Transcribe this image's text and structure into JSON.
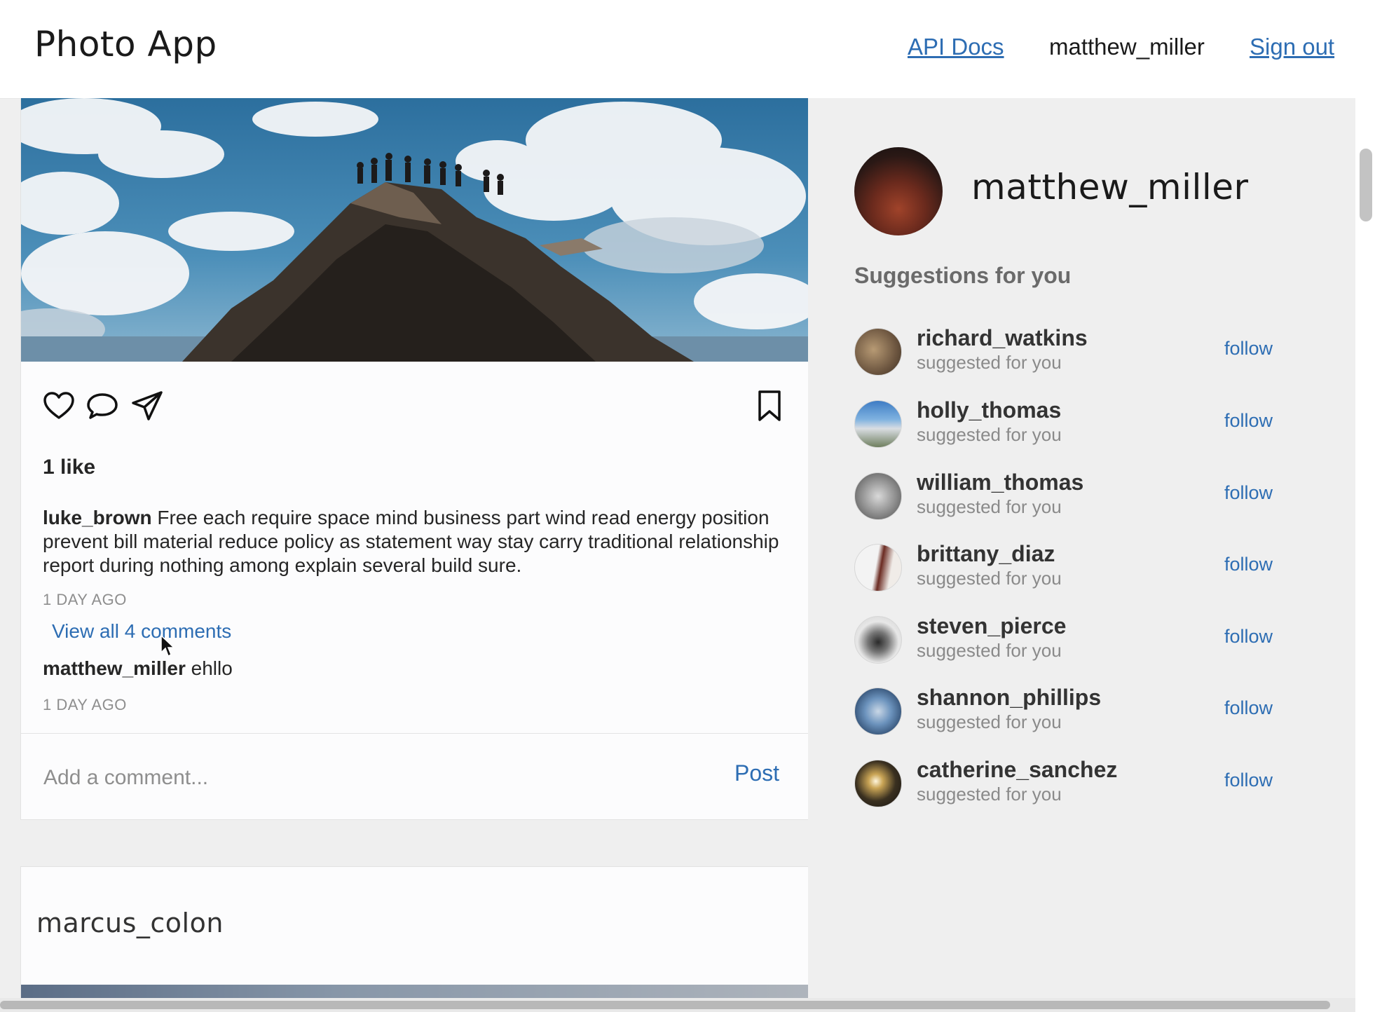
{
  "header": {
    "logo": "Photo App",
    "api_docs": "API Docs",
    "username": "matthew_miller",
    "sign_out": "Sign out"
  },
  "post": {
    "likes": "1 like",
    "author": "luke_brown",
    "caption": " Free each require space mind business part wind read energy position prevent bill material reduce policy as statement way stay carry traditional relationship report during nothing among explain several build sure.",
    "timestamp": "1 DAY AGO",
    "view_all_comments": "View all 4 comments",
    "comment_author": "matthew_miller",
    "comment_text": " ehllo",
    "comment_timestamp": "1 DAY AGO",
    "add_comment_placeholder": "Add a comment...",
    "post_button": "Post",
    "icons": [
      "heart-icon",
      "comment-icon",
      "share-icon",
      "bookmark-icon"
    ]
  },
  "next_post": {
    "author": "marcus_colon"
  },
  "sidebar": {
    "profile_name": "matthew_miller",
    "suggestions_heading": "Suggestions for you",
    "suggestions": [
      {
        "name": "richard_watkins",
        "subtitle": "suggested for you",
        "action": "follow"
      },
      {
        "name": "holly_thomas",
        "subtitle": "suggested for you",
        "action": "follow"
      },
      {
        "name": "william_thomas",
        "subtitle": "suggested for you",
        "action": "follow"
      },
      {
        "name": "brittany_diaz",
        "subtitle": "suggested for you",
        "action": "follow"
      },
      {
        "name": "steven_pierce",
        "subtitle": "suggested for you",
        "action": "follow"
      },
      {
        "name": "shannon_phillips",
        "subtitle": "suggested for you",
        "action": "follow"
      },
      {
        "name": "catherine_sanchez",
        "subtitle": "suggested for you",
        "action": "follow"
      }
    ]
  },
  "colors": {
    "link": "#2d6db3",
    "background": "#efefef",
    "card": "#fcfcfd"
  }
}
